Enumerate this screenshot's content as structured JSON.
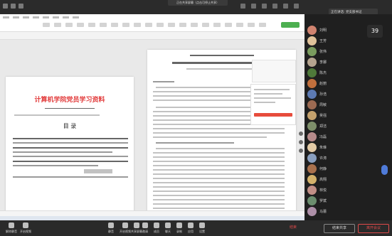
{
  "meeting": {
    "share_banner": "正在共享屏幕（点击可停止共享）",
    "active_speaker": "正在讲话: 党支部书记",
    "counter": "39"
  },
  "document": {
    "title": "计算机学院党员学习资料",
    "toc": "目  录"
  },
  "toolbar": {
    "items": [
      {
        "label": "静音"
      },
      {
        "label": "开启视频"
      },
      {
        "label": "共享屏幕"
      },
      {
        "label": "邀请"
      },
      {
        "label": "成员"
      },
      {
        "label": "聊天"
      },
      {
        "label": "录制"
      },
      {
        "label": "应用"
      },
      {
        "label": "设置"
      }
    ],
    "left_label": "解除静音",
    "left_label2": "开启视频",
    "right_btn": "结束共享",
    "leave": "离开会议",
    "small_red": "结束"
  },
  "participants": [
    {
      "name": "刘明",
      "color": "#d0836f"
    },
    {
      "name": "王芳",
      "color": "#e0c29a"
    },
    {
      "name": "张伟",
      "color": "#7a9c5e"
    },
    {
      "name": "李娜",
      "color": "#b5a48f"
    },
    {
      "name": "陈杰",
      "color": "#4f7a3a"
    },
    {
      "name": "赵丽",
      "color": "#c2703d"
    },
    {
      "name": "孙浩",
      "color": "#5d7bb4"
    },
    {
      "name": "周敏",
      "color": "#9c6a52"
    },
    {
      "name": "吴强",
      "color": "#c5a26d"
    },
    {
      "name": "郑洁",
      "color": "#7e8f6a"
    },
    {
      "name": "冯磊",
      "color": "#b78b8b"
    },
    {
      "name": "朱琳",
      "color": "#e3cba6"
    },
    {
      "name": "许涛",
      "color": "#8a9fbf"
    },
    {
      "name": "何静",
      "color": "#a9714d"
    },
    {
      "name": "高翔",
      "color": "#d4b26b"
    },
    {
      "name": "林悦",
      "color": "#c18f86"
    },
    {
      "name": "罗斌",
      "color": "#6b8d6e"
    },
    {
      "name": "马蕾",
      "color": "#ad8fa8"
    }
  ]
}
